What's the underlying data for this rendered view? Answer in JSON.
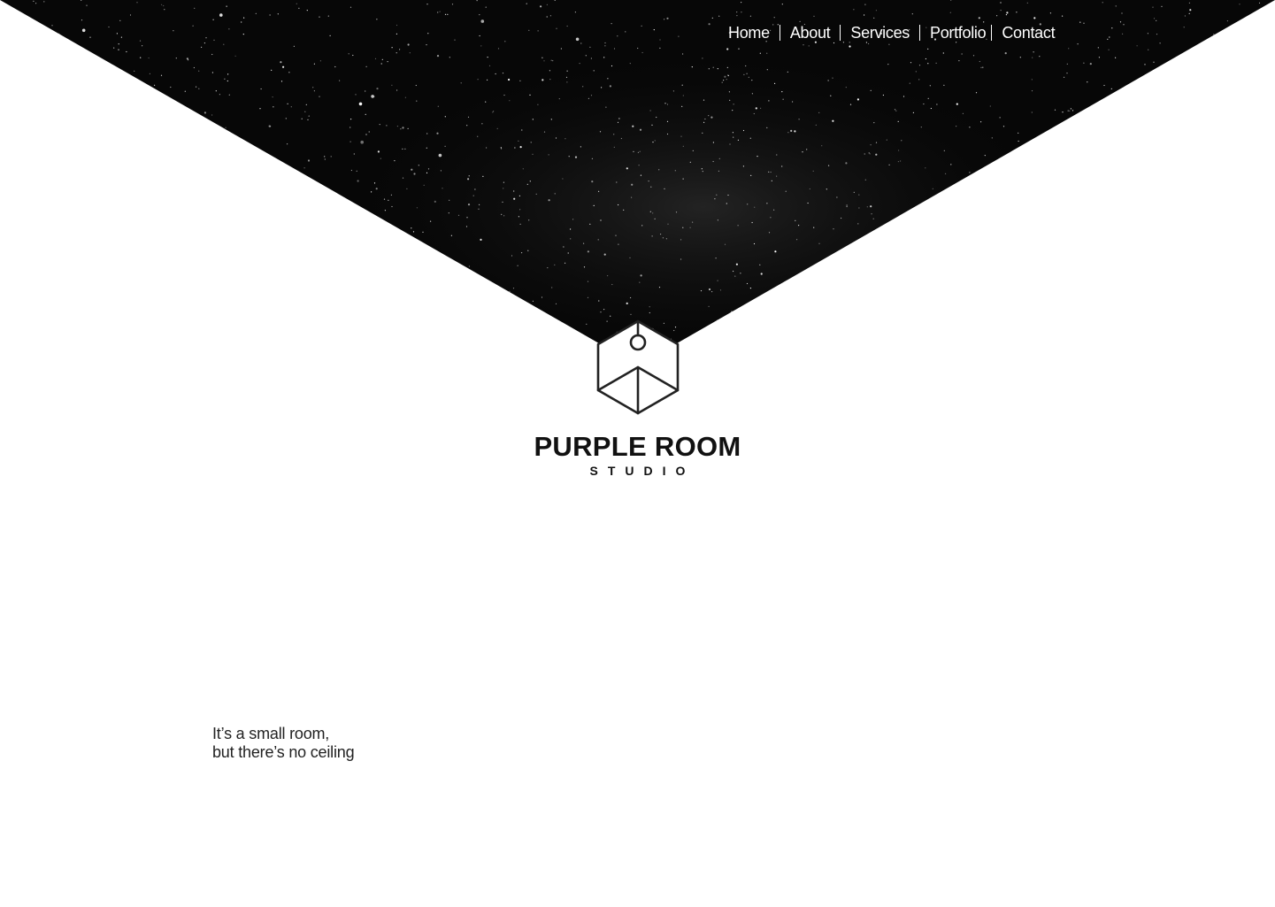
{
  "nav": {
    "items": [
      {
        "label": "Home"
      },
      {
        "label": "About"
      },
      {
        "label": "Services"
      },
      {
        "label": "Portfolio"
      },
      {
        "label": "Contact"
      }
    ]
  },
  "hero": {
    "background": "starfield-image",
    "logo_icon": "hexagon-cube-lamp-icon"
  },
  "brand": {
    "title": "PURPLE ROOM",
    "subtitle": "STUDIO"
  },
  "tagline": {
    "line1": "It’s a small room,",
    "line2": "but there’s no ceiling"
  },
  "colors": {
    "text": "#111111",
    "nav_text": "#ffffff",
    "sky": "#0a0a0a",
    "background": "#ffffff"
  }
}
